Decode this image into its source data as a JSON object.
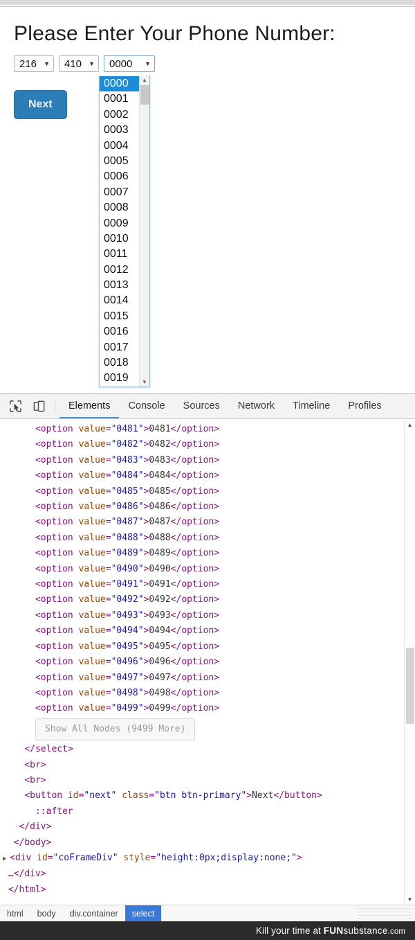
{
  "page": {
    "heading": "Please Enter Your Phone Number:",
    "selects": [
      {
        "name": "area-code",
        "value": "216",
        "caret": "▼"
      },
      {
        "name": "prefix",
        "value": "410",
        "caret": "▼"
      },
      {
        "name": "line-number",
        "value": "0000",
        "caret": "▼"
      }
    ],
    "dropdown": {
      "selected": "0000",
      "up_arrow": "▲",
      "down_arrow": "▼",
      "options": [
        "0000",
        "0001",
        "0002",
        "0003",
        "0004",
        "0005",
        "0006",
        "0007",
        "0008",
        "0009",
        "0010",
        "0011",
        "0012",
        "0013",
        "0014",
        "0015",
        "0016",
        "0017",
        "0018",
        "0019"
      ]
    },
    "next_button": "Next"
  },
  "devtools": {
    "icons": {
      "inspect": "inspect-element-icon",
      "device": "device-toolbar-icon"
    },
    "tabs": [
      {
        "label": "Elements",
        "active": true
      },
      {
        "label": "Console",
        "active": false
      },
      {
        "label": "Sources",
        "active": false
      },
      {
        "label": "Network",
        "active": false
      },
      {
        "label": "Timeline",
        "active": false
      },
      {
        "label": "Profiles",
        "active": false
      }
    ],
    "dom_lines": [
      {
        "type": "option",
        "value": "0481"
      },
      {
        "type": "option",
        "value": "0482"
      },
      {
        "type": "option",
        "value": "0483"
      },
      {
        "type": "option",
        "value": "0484"
      },
      {
        "type": "option",
        "value": "0485"
      },
      {
        "type": "option",
        "value": "0486"
      },
      {
        "type": "option",
        "value": "0487"
      },
      {
        "type": "option",
        "value": "0488"
      },
      {
        "type": "option",
        "value": "0489"
      },
      {
        "type": "option",
        "value": "0490"
      },
      {
        "type": "option",
        "value": "0491"
      },
      {
        "type": "option",
        "value": "0492"
      },
      {
        "type": "option",
        "value": "0493"
      },
      {
        "type": "option",
        "value": "0494"
      },
      {
        "type": "option",
        "value": "0495"
      },
      {
        "type": "option",
        "value": "0496"
      },
      {
        "type": "option",
        "value": "0497"
      },
      {
        "type": "option",
        "value": "0498"
      },
      {
        "type": "option",
        "value": "0499"
      }
    ],
    "show_all_nodes": "Show All Nodes (9499 More)",
    "tail": {
      "close_select": "</select>",
      "br1": "<br>",
      "br2": "<br>",
      "button_tag": "button",
      "button_id_attr": "id",
      "button_id_value": "next",
      "button_class_attr": "class",
      "button_class_value": "btn btn-primary",
      "button_text": "Next",
      "pseudo_after": "::after",
      "close_div": "</div>",
      "close_body": "</body>",
      "frame_tag": "div",
      "frame_id_attr": "id",
      "frame_id_value": "coFrameDiv",
      "frame_style_attr": "style",
      "frame_style_value": "height:0px;display:none;",
      "frame_collapsed": "…</div>",
      "close_html": "</html>",
      "triangle": "▶"
    },
    "breadcrumbs": [
      {
        "label": "html",
        "active": false
      },
      {
        "label": "body",
        "active": false
      },
      {
        "label": "div.container",
        "active": false
      },
      {
        "label": "select",
        "active": true
      }
    ],
    "scroll": {
      "up": "▲",
      "down": "▼"
    }
  },
  "footer": {
    "prefix": "Kill your time at ",
    "brand_bold": "FUN",
    "brand_rest": "substance",
    "brand_tld": ".com"
  }
}
